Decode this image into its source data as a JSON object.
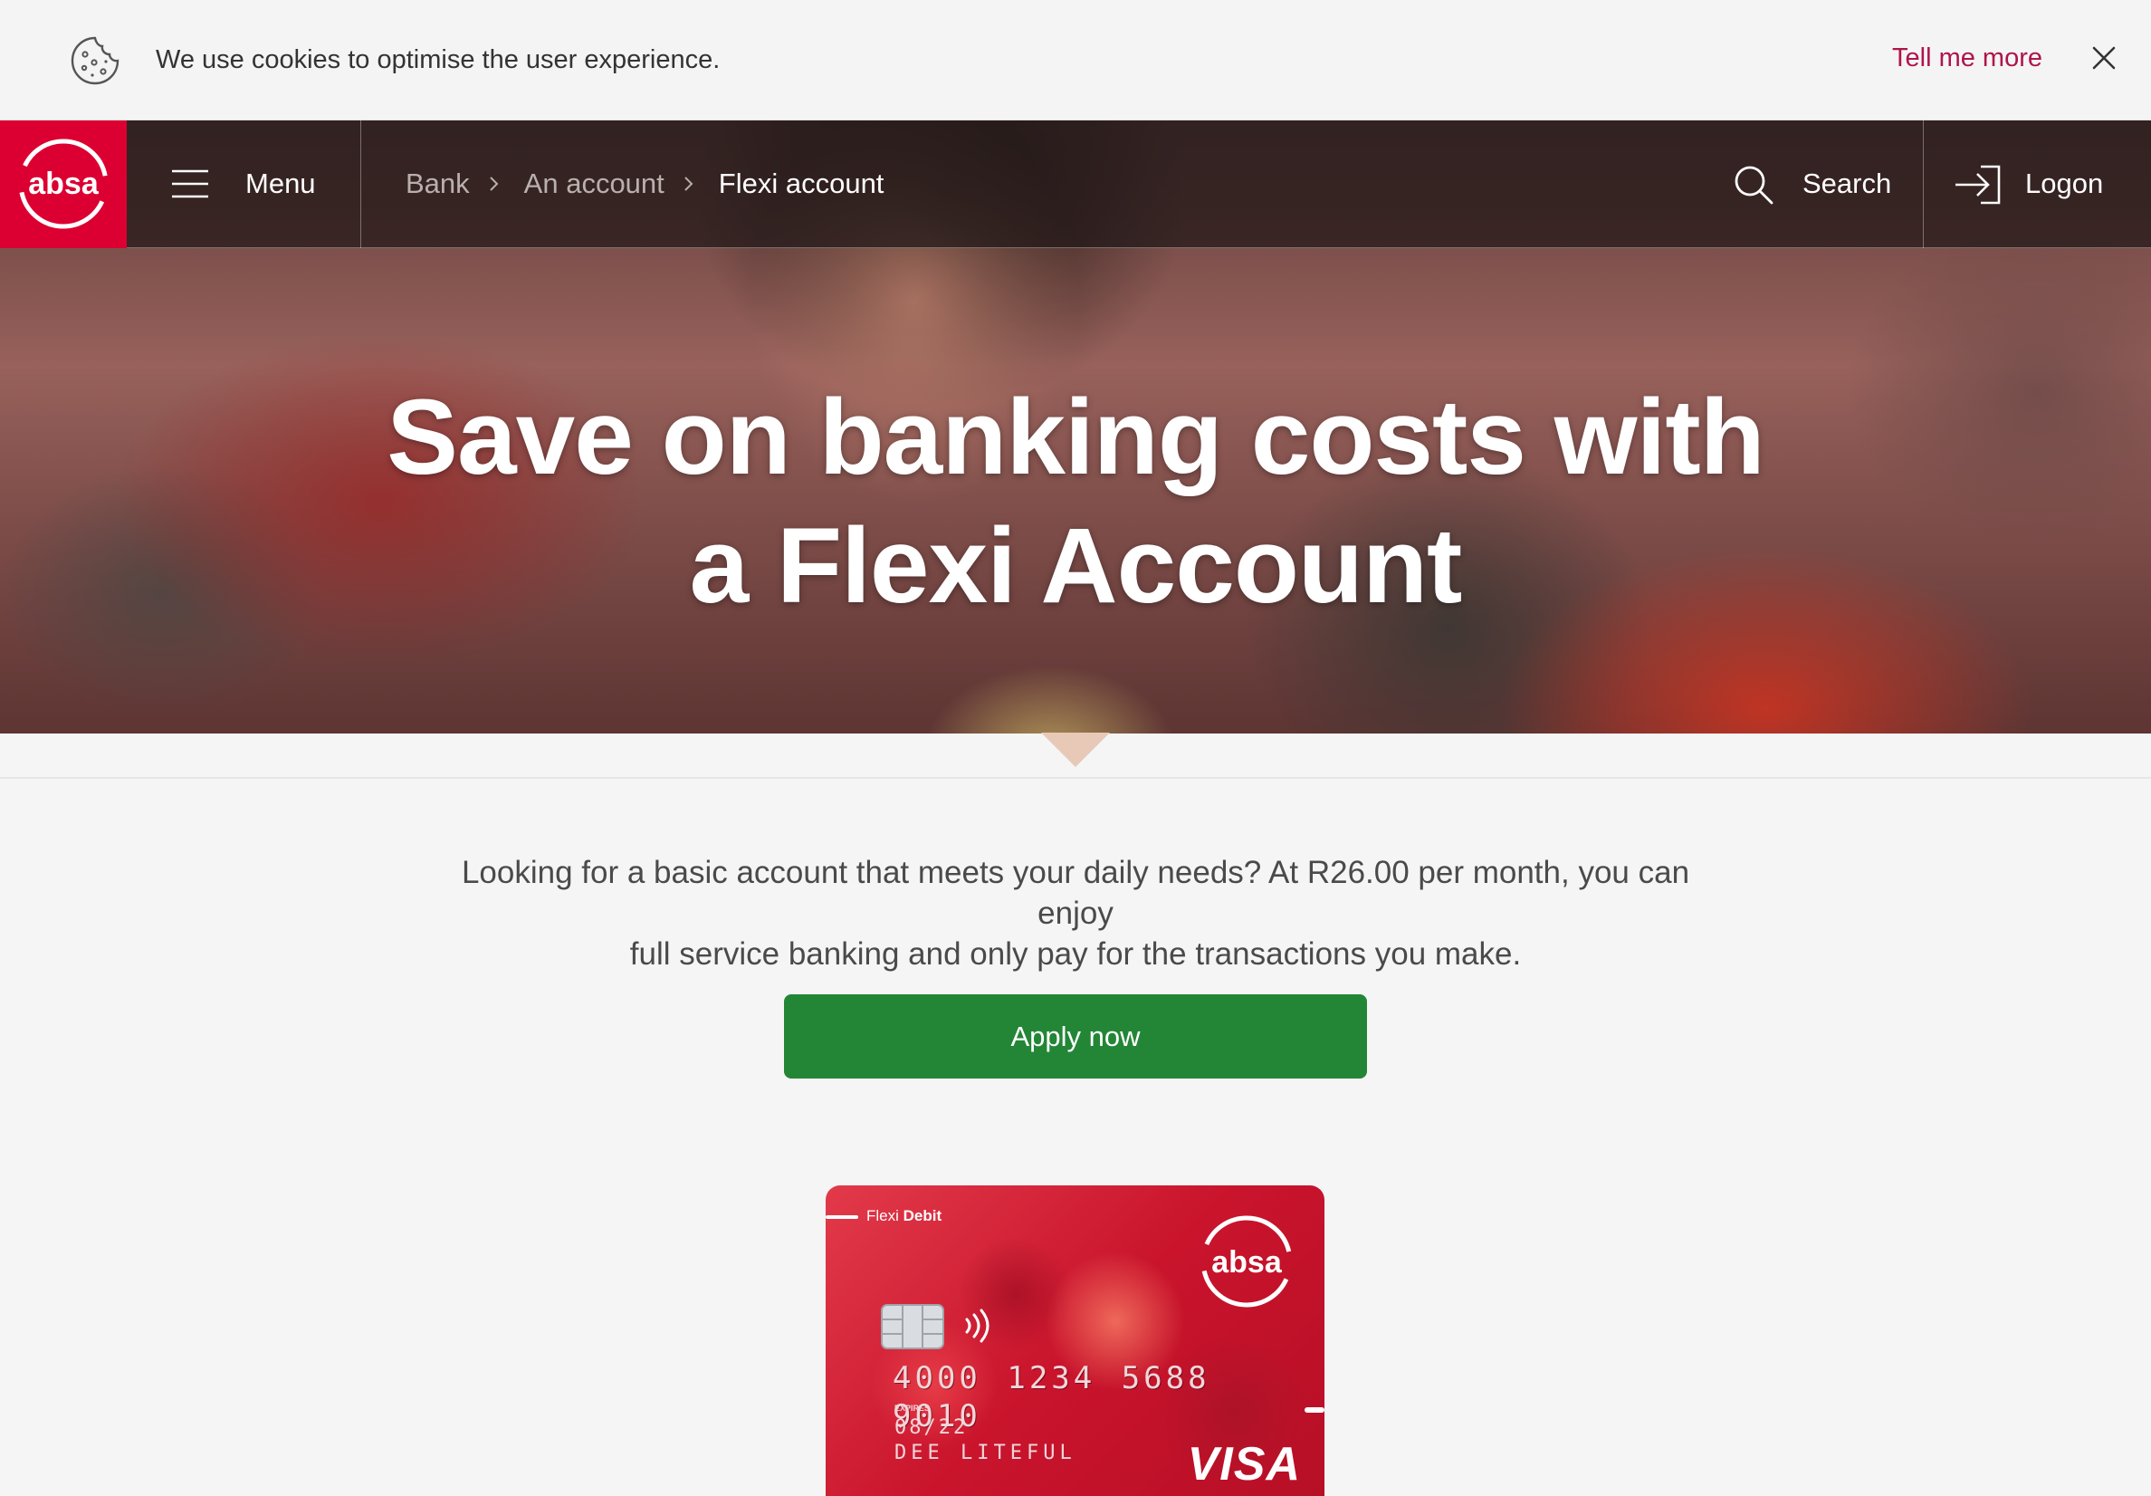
{
  "cookie_bar": {
    "icon": "cookie-icon",
    "text": "We use cookies to optimise the user experience.",
    "link_label": "Tell me more",
    "close_icon": "close-icon"
  },
  "nav": {
    "logo_text": "absa",
    "menu_label": "Menu",
    "breadcrumb": [
      "Bank",
      "An account",
      "Flexi account"
    ],
    "search_label": "Search",
    "logon_label": "Logon"
  },
  "hero": {
    "title_line1": "Save on banking costs with",
    "title_line2": "a Flexi Account"
  },
  "content": {
    "intro_line1": "Looking for a basic account that meets your daily needs? At R26.00 per month, you can enjoy",
    "intro_line2": "full service banking and only pay for the transactions you make.",
    "apply_label": "Apply now"
  },
  "card": {
    "brand_prefix": "Flexi",
    "brand_name": "Debit",
    "logo_text": "absa",
    "number": "4000 1234 5688 9010",
    "expires_label": "EXPIRES",
    "expiry": "08/22",
    "holder": "DEE LITEFUL",
    "network": "VISA"
  },
  "colors": {
    "brand_red": "#dc0032",
    "link_red": "#af144b",
    "apply_green": "#238636",
    "page_bg": "#f5f5f5"
  }
}
